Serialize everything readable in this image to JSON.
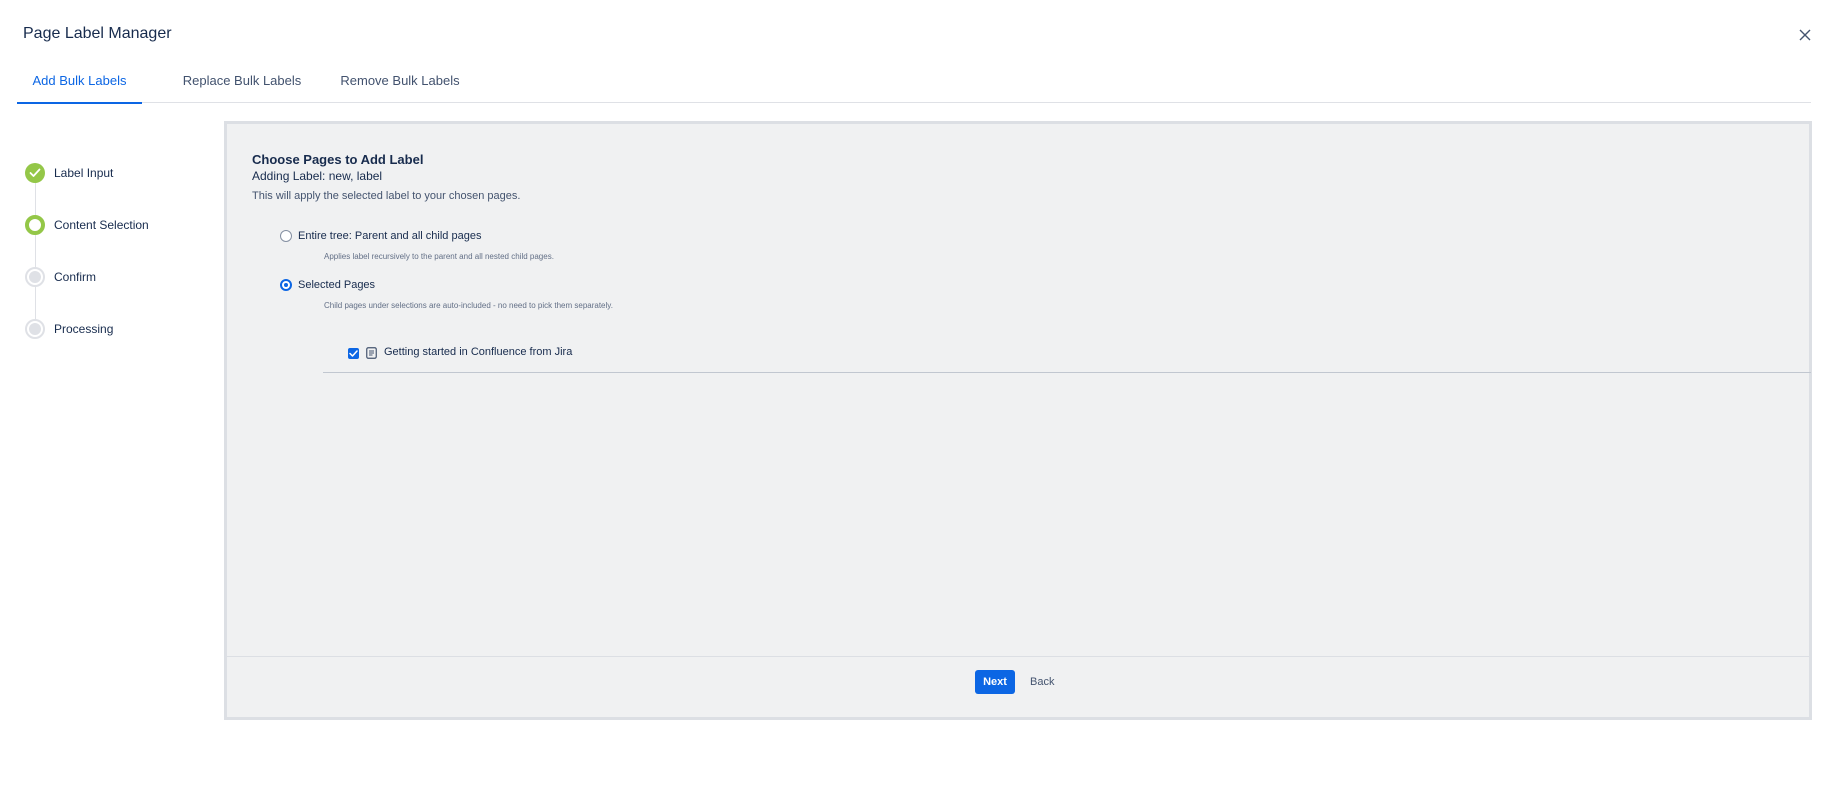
{
  "app": {
    "title": "Page Label Manager"
  },
  "tabs": [
    {
      "label": "Add Bulk Labels",
      "active": true
    },
    {
      "label": "Replace Bulk Labels",
      "active": false
    },
    {
      "label": "Remove Bulk Labels",
      "active": false
    }
  ],
  "steps": [
    {
      "label": "Label Input",
      "state": "done"
    },
    {
      "label": "Content Selection",
      "state": "current"
    },
    {
      "label": "Confirm",
      "state": "pending"
    },
    {
      "label": "Processing",
      "state": "pending"
    }
  ],
  "panel": {
    "heading": "Choose Pages to Add Label",
    "adding_label": "Adding Label: new, label",
    "description": "This will apply the selected label to your chosen pages.",
    "options": [
      {
        "label": "Entire tree: Parent and all child pages",
        "help": "Applies label recursively to the parent and all nested child pages.",
        "checked": false
      },
      {
        "label": "Selected Pages",
        "help": "Child pages under selections are auto-included - no need to pick them separately.",
        "checked": true
      }
    ],
    "selected_pages": [
      {
        "title": "Getting started in Confluence from Jira",
        "checked": true,
        "icon": "page-icon"
      }
    ]
  },
  "footer": {
    "next_label": "Next",
    "back_label": "Back"
  },
  "colors": {
    "accent": "#0c66e4",
    "step_complete": "#94c748",
    "panel_bg": "#f0f1f2"
  }
}
